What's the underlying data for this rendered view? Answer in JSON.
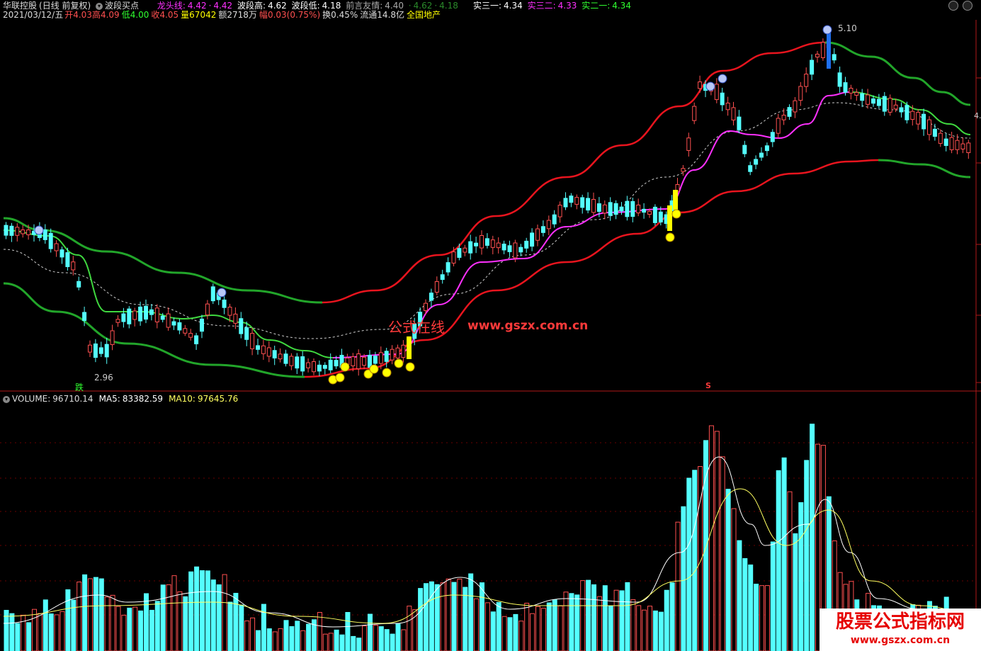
{
  "header": {
    "stock_name": "华联控股",
    "period": "(日线 前复权)",
    "indicator_name": "波段买点",
    "dragon_line_label": "龙头线:",
    "dragon_line_val1": "4.42",
    "dragon_line_val2": "4.42",
    "wave_high_label": "波段高:",
    "wave_high_val": "4.62",
    "wave_low_label": "波段低:",
    "wave_low_val": "4.18",
    "prev_label": "前言友情:",
    "prev_val": "4.40",
    "green_val1": "4.62",
    "green_val2": "4.18",
    "real31_label": "实三一:",
    "real31_val": "4.34",
    "real32_label": "实三二:",
    "real32_val": "4.33",
    "real21_label": "实二一:",
    "real21_val": "4.34"
  },
  "quote": {
    "date": "2021/03/12/五",
    "open_label": "开",
    "open": "4.03",
    "high_label": "高",
    "high": "4.09",
    "low_label": "低",
    "low": "4.00",
    "close_label": "收",
    "close": "4.05",
    "vol_label": "量",
    "vol": "67042",
    "amt_label": "额",
    "amt": "2718万",
    "chg_label": "幅",
    "chg": "0.03(0.75%)",
    "turnover_label": "换",
    "turnover": "0.45%",
    "float_label": "流通",
    "float": "14.8亿",
    "sector": "全国地产"
  },
  "annotations": {
    "high_price": "5.10",
    "low_price": "2.96",
    "low_marker": "跌",
    "right_price": "4.",
    "watermark": "公式在线",
    "watermark_url": "www.gszx.com.cn",
    "sell_marker": "S"
  },
  "volume_header": {
    "vol_label": "VOLUME:",
    "vol_val": "96710.14",
    "ma5_label": "MA5:",
    "ma5_val": "83382.59",
    "ma10_label": "MA10:",
    "ma10_val": "97645.76"
  },
  "footer_logo": {
    "title": "股票公式指标网",
    "url": "www.gszx.com.cn"
  },
  "colors": {
    "up": "#ff5050",
    "down": "#54ffff",
    "red_band": "#e8141e",
    "green_band": "#22a52a",
    "magenta": "#ff30ff",
    "yellow": "#ffff00"
  }
}
